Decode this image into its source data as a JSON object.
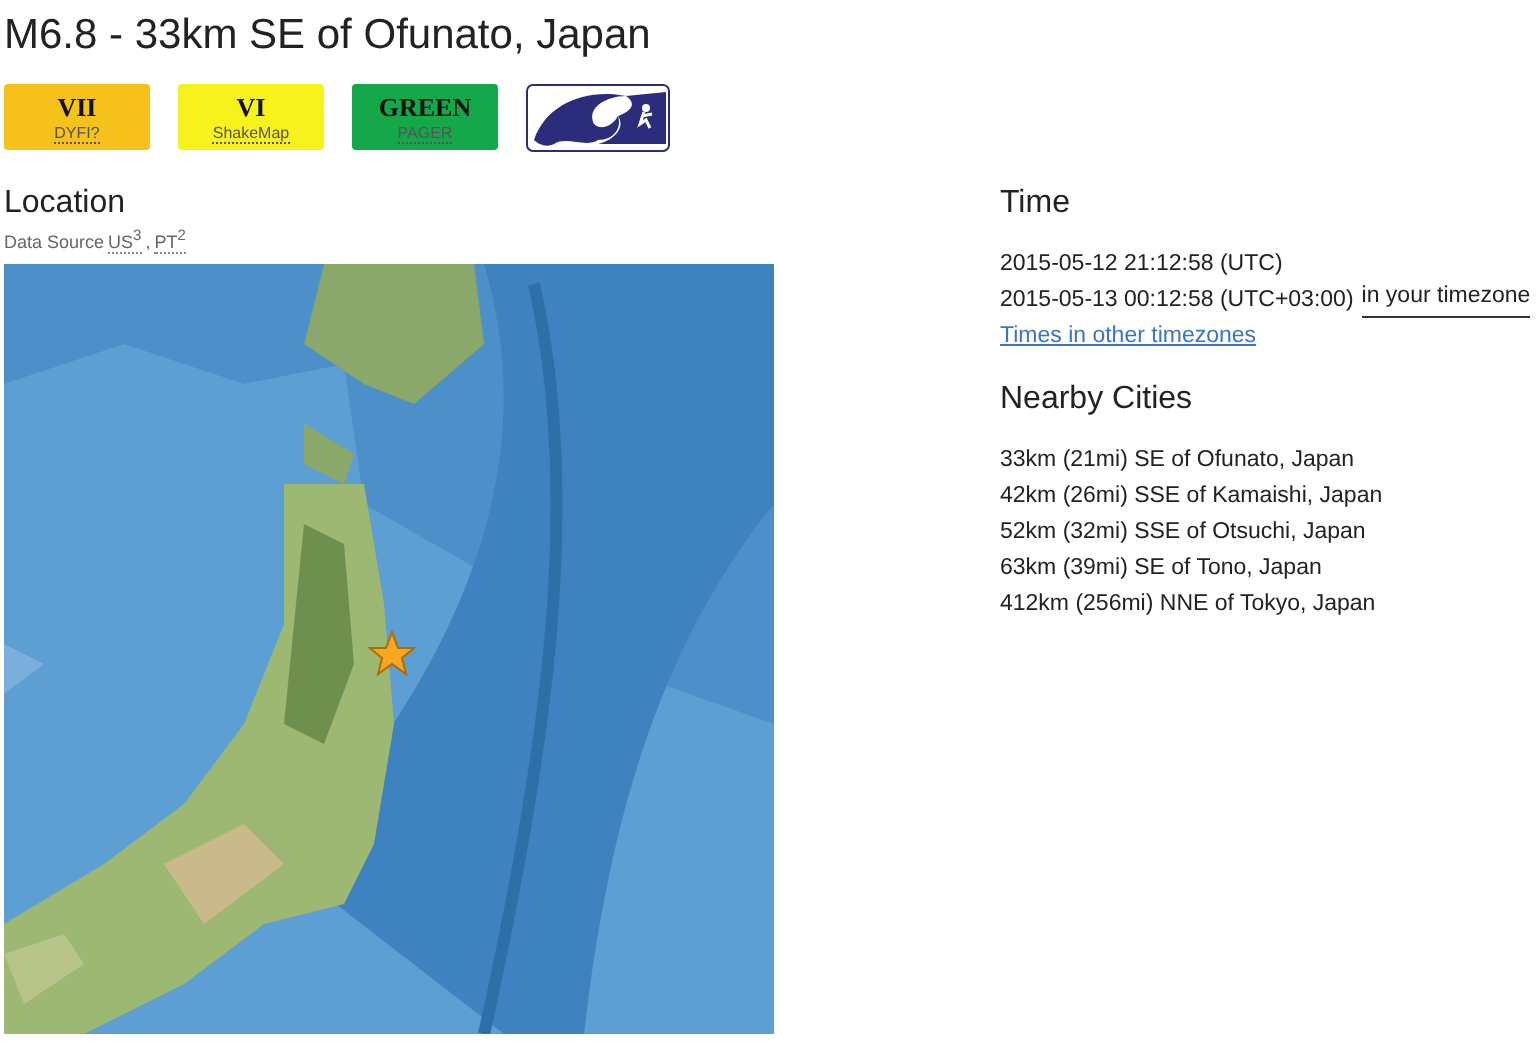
{
  "title": "M6.8 - 33km SE of Ofunato, Japan",
  "badges": [
    {
      "kind": "level",
      "value": "VII",
      "label": "DYFI?",
      "color": "#f5c11a"
    },
    {
      "kind": "level",
      "value": "VI",
      "label": "ShakeMap",
      "color": "#f7f21c"
    },
    {
      "kind": "level",
      "value": "GREEN",
      "label": "PAGER",
      "color": "#14a84a"
    },
    {
      "kind": "tsunami"
    }
  ],
  "location": {
    "heading": "Location",
    "source_label": "Data Source",
    "sources": [
      "US$^{3}$",
      "PT$^{2}$"
    ],
    "separator": ","
  },
  "time": {
    "heading": "Time",
    "utc": "2015-05-12 21:12:58 (UTC)",
    "local": "2015-05-13 00:12:58 (UTC+03:00)",
    "local_link": "in your timezone",
    "other_link": "Times in other timezones"
  },
  "nearby": {
    "heading": "Nearby Cities",
    "cities": [
      "33km (21mi) SE of Ofunato, Japan",
      "42km (26mi) SSE of Kamaishi, Japan",
      "52km (32mi) SSE of Otsuchi, Japan",
      "63km (39mi) SE of Tono, Japan",
      "412km (256mi) NNE of Tokyo, Japan"
    ]
  }
}
